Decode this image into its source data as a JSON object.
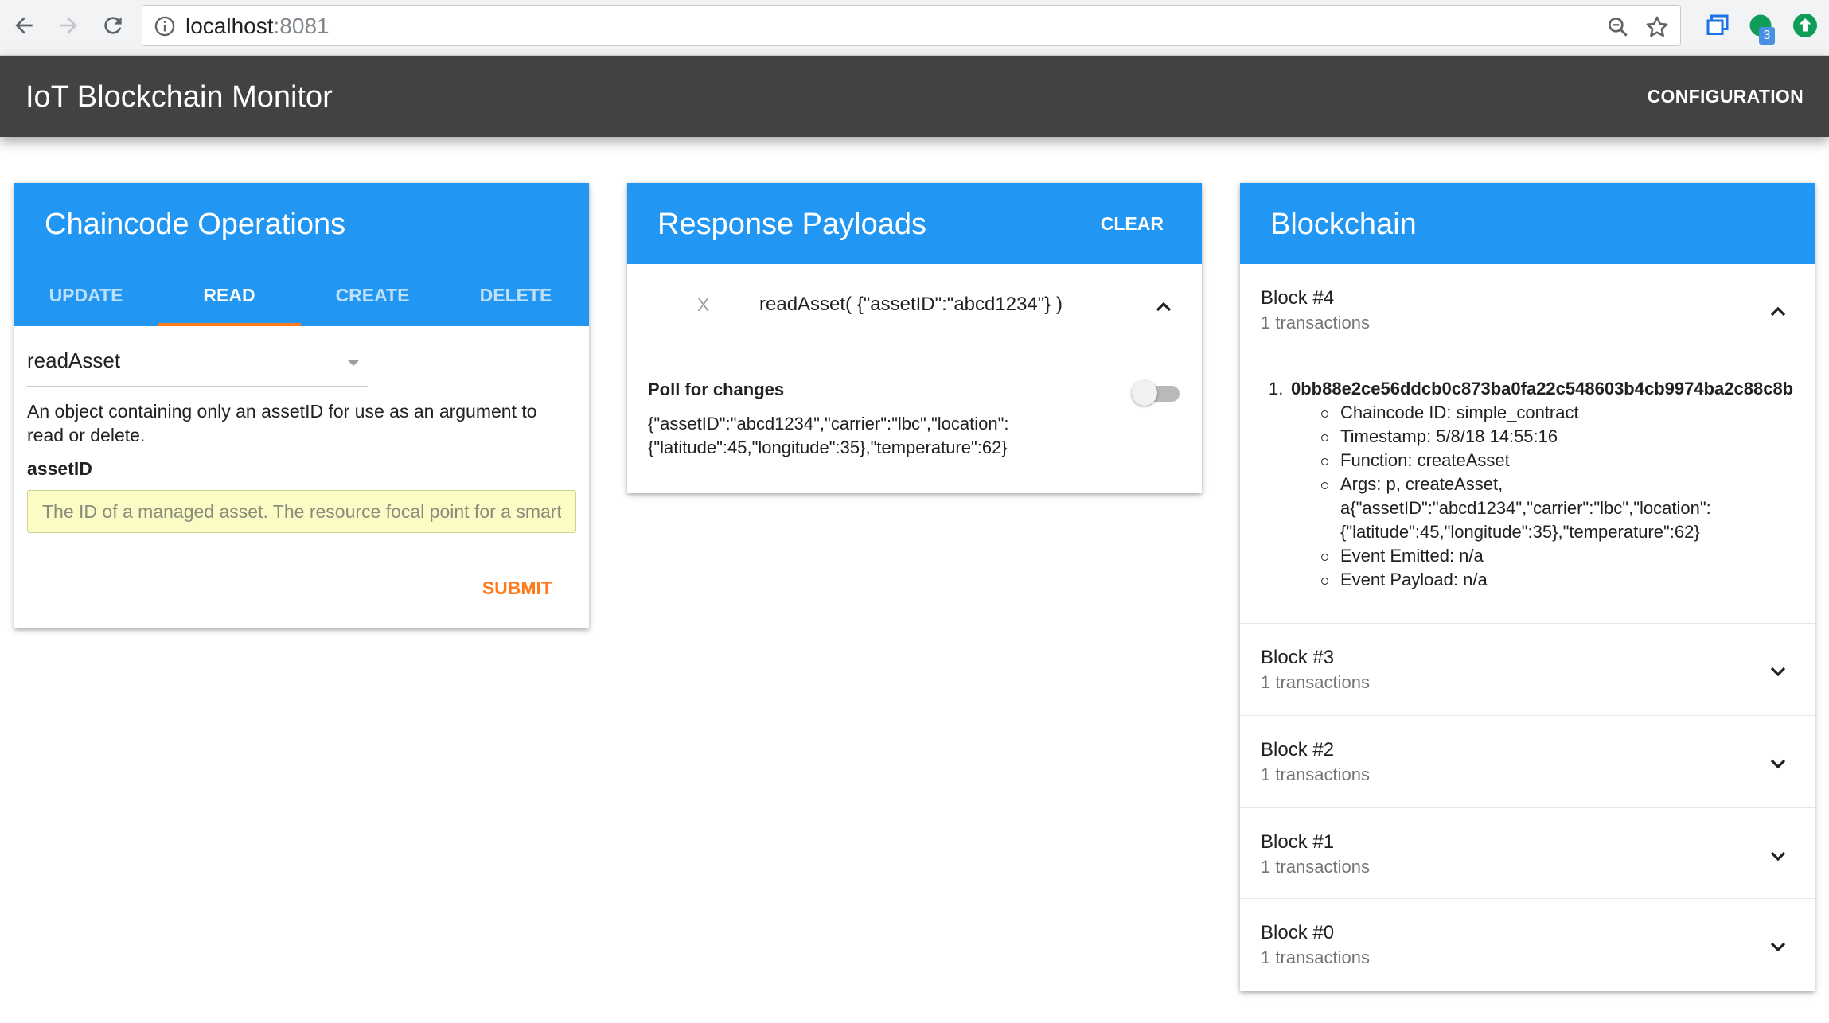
{
  "browser": {
    "url_host": "localhost",
    "url_port": ":8081",
    "extension_badge": "3"
  },
  "appbar": {
    "title": "IoT Blockchain Monitor",
    "config_label": "CONFIGURATION"
  },
  "ops": {
    "title": "Chaincode Operations",
    "tabs": [
      "UPDATE",
      "READ",
      "CREATE",
      "DELETE"
    ],
    "active_tab": "READ",
    "selected_function": "readAsset",
    "description": "An object containing only an assetID for use as an argument to read or delete.",
    "field_label": "assetID",
    "field_placeholder": "The ID of a managed asset. The resource focal point for a smart contract.",
    "field_value": "",
    "submit_label": "SUBMIT"
  },
  "responses": {
    "title": "Response Payloads",
    "clear_label": "CLEAR",
    "item": {
      "remove_label": "X",
      "call": "readAsset( {\"assetID\":\"abcd1234\"} )",
      "poll_label": "Poll for changes",
      "poll_enabled": false,
      "payload": "{\"assetID\":\"abcd1234\",\"carrier\":\"lbc\",\"location\": {\"latitude\":45,\"longitude\":35},\"temperature\":62}"
    }
  },
  "blockchain": {
    "title": "Blockchain",
    "blocks": [
      {
        "title": "Block #4",
        "subtitle": "1 transactions",
        "expanded": true,
        "tx": {
          "index": "1.",
          "hash": "0bb88e2ce56ddcb0c873ba0fa22c548603b4cb9974ba2c88c8b",
          "details": [
            "Chaincode ID: simple_contract",
            "Timestamp: 5/8/18 14:55:16",
            "Function: createAsset",
            "Args: p, createAsset, a{\"assetID\":\"abcd1234\",\"carrier\":\"lbc\",\"location\": {\"latitude\":45,\"longitude\":35},\"temperature\":62}",
            "Event Emitted: n/a",
            "Event Payload: n/a"
          ]
        }
      },
      {
        "title": "Block #3",
        "subtitle": "1 transactions",
        "expanded": false
      },
      {
        "title": "Block #2",
        "subtitle": "1 transactions",
        "expanded": false
      },
      {
        "title": "Block #1",
        "subtitle": "1 transactions",
        "expanded": false
      },
      {
        "title": "Block #0",
        "subtitle": "1 transactions",
        "expanded": false
      }
    ]
  },
  "colors": {
    "appbar": "#424242",
    "primary": "#2196f3",
    "accent": "#ff7a1a",
    "input_bg": "#fbfbc6"
  },
  "icons": {
    "back": "arrow-left-icon",
    "forward": "arrow-right-icon",
    "reload": "reload-icon",
    "info": "info-icon",
    "zoom": "magnifier-icon",
    "bookmark": "star-icon",
    "collapse": "chevron-up-icon",
    "expand": "chevron-down-icon"
  }
}
